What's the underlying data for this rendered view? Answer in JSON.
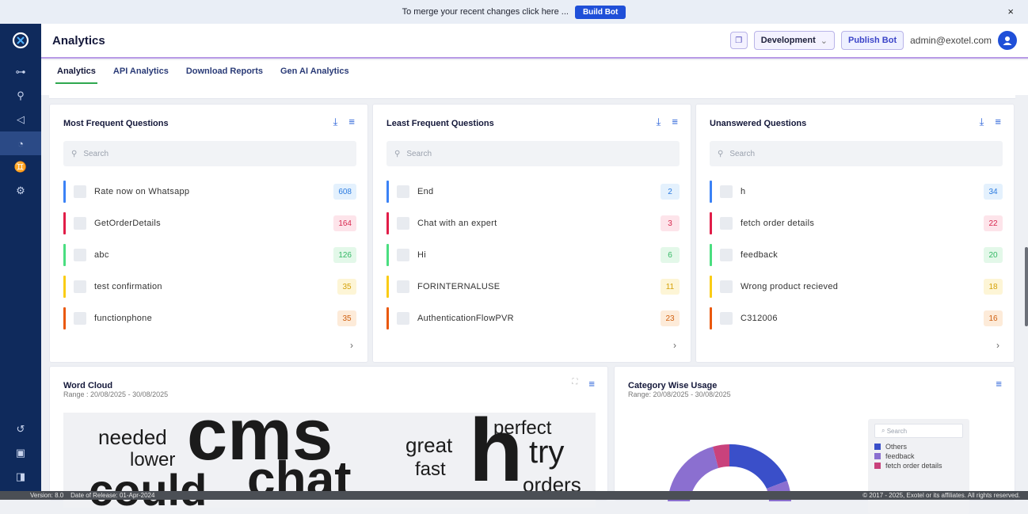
{
  "banner": {
    "message": "To merge your recent changes click here ...",
    "button": "Build Bot",
    "close": "×"
  },
  "header": {
    "title": "Analytics",
    "environment": "Development",
    "publish": "Publish Bot",
    "user_email": "admin@exotel.com"
  },
  "tabs": [
    "Analytics",
    "API Analytics",
    "Download Reports",
    "Gen AI Analytics"
  ],
  "search_placeholder": "Search",
  "colors": {
    "blue": "#3b82f6",
    "red": "#e11d48",
    "green": "#4ade80",
    "yellow": "#facc15",
    "orange": "#ea580c",
    "sidebar": "#0f2a5c",
    "accent": "#1f4fd8"
  },
  "cards": [
    {
      "title": "Most Frequent Questions",
      "rows": [
        {
          "label": "Rate now on Whatsapp",
          "count": "608",
          "color": "#3b82f6"
        },
        {
          "label": "GetOrderDetails",
          "count": "164",
          "color": "#e11d48"
        },
        {
          "label": "abc",
          "count": "126",
          "color": "#4ade80"
        },
        {
          "label": "test confirmation",
          "count": "35",
          "color": "#facc15"
        },
        {
          "label": "functionphone",
          "count": "35",
          "color": "#ea580c"
        }
      ]
    },
    {
      "title": "Least Frequent Questions",
      "rows": [
        {
          "label": "End",
          "count": "2",
          "color": "#3b82f6"
        },
        {
          "label": "Chat with an expert",
          "count": "3",
          "color": "#e11d48"
        },
        {
          "label": "Hi",
          "count": "6",
          "color": "#4ade80"
        },
        {
          "label": "FORINTERNALUSE",
          "count": "11",
          "color": "#facc15"
        },
        {
          "label": "AuthenticationFlowPVR",
          "count": "23",
          "color": "#ea580c"
        }
      ]
    },
    {
      "title": "Unanswered Questions",
      "rows": [
        {
          "label": "h",
          "count": "34",
          "color": "#3b82f6"
        },
        {
          "label": "fetch order details",
          "count": "22",
          "color": "#e11d48"
        },
        {
          "label": "feedback",
          "count": "20",
          "color": "#4ade80"
        },
        {
          "label": "Wrong product recieved",
          "count": "18",
          "color": "#facc15"
        },
        {
          "label": "C312006",
          "count": "16",
          "color": "#ea580c"
        }
      ]
    }
  ],
  "word_cloud": {
    "title": "Word Cloud",
    "range": "Range : 20/08/2025 - 30/08/2025",
    "words": [
      "needed",
      "cms",
      "great",
      "perfect",
      "lower",
      "h",
      "try",
      "fast",
      "could",
      "chat",
      "orders"
    ]
  },
  "category_usage": {
    "title": "Category Wise Usage",
    "range": "Range: 20/08/2025 - 30/08/2025",
    "legend_search": "Search",
    "legend": [
      {
        "name": "Others",
        "color": "#3a4fc9"
      },
      {
        "name": "feedback",
        "color": "#8b6fd0"
      },
      {
        "name": "fetch order details",
        "color": "#c9427c"
      }
    ]
  },
  "footer": {
    "version": "Version: 8.0",
    "release": "Date of Release: 01-Apr-2024",
    "copyright": "© 2017 - 2025, Exotel or its affiliates. All rights reserved."
  }
}
